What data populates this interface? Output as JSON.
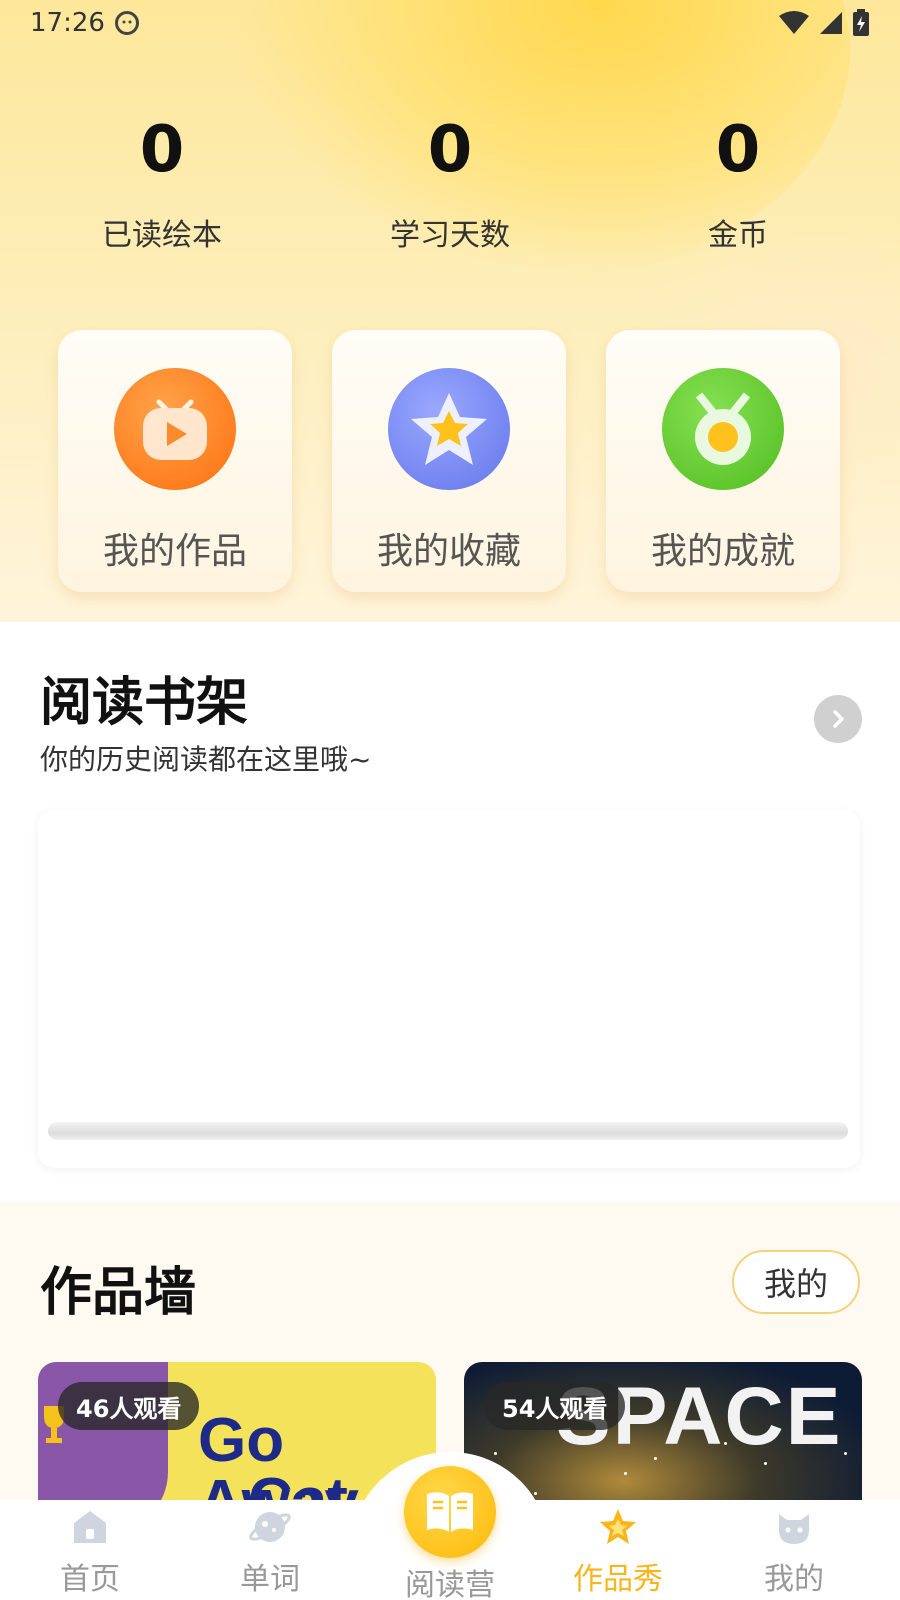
{
  "status_bar": {
    "time": "17:26",
    "icons": [
      "cat-face-icon",
      "wifi-icon",
      "signal-icon",
      "battery-icon"
    ]
  },
  "stats": [
    {
      "value": "0",
      "label": "已读绘本"
    },
    {
      "value": "0",
      "label": "学习天数"
    },
    {
      "value": "0",
      "label": "金币"
    }
  ],
  "feature_cards": [
    {
      "label": "我的作品",
      "icon": "video-play-icon",
      "color": "#ff8a2a"
    },
    {
      "label": "我的收藏",
      "icon": "star-icon",
      "color": "#7b8df5"
    },
    {
      "label": "我的成就",
      "icon": "medal-icon",
      "color": "#6ccf3a"
    }
  ],
  "reading_shelf": {
    "title": "阅读书架",
    "subtitle": "你的历史阅读都在这里哦~"
  },
  "works_wall": {
    "title": "作品墙",
    "mine_button": "我的",
    "items": [
      {
        "views": "46人观看",
        "cover_line1": "Go Away",
        "cover_line2": "Cat"
      },
      {
        "views": "54人观看",
        "cover_text": "SPACE"
      }
    ]
  },
  "bottom_nav": {
    "items": [
      {
        "label": "首页",
        "icon": "home-icon"
      },
      {
        "label": "单词",
        "icon": "planet-icon"
      },
      {
        "label": "阅读营",
        "icon": "open-book-icon"
      },
      {
        "label": "作品秀",
        "icon": "star-icon"
      },
      {
        "label": "我的",
        "icon": "cat-face-icon"
      }
    ],
    "active": "作品秀"
  },
  "colors": {
    "accent": "#f9b51b",
    "inactive": "#999999"
  }
}
